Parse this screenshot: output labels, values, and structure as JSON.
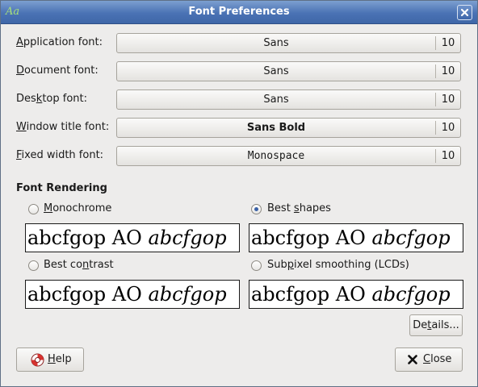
{
  "window": {
    "title": "Font Preferences",
    "icon": "font-preferences-icon",
    "icon_glyph": "Aa"
  },
  "fonts": [
    {
      "label_pre": "",
      "label_key": "A",
      "label_post": "pplication font:",
      "font": "Sans",
      "size": "10",
      "weight": "normal"
    },
    {
      "label_pre": "",
      "label_key": "D",
      "label_post": "ocument font:",
      "font": "Sans",
      "size": "10",
      "weight": "normal"
    },
    {
      "label_pre": "Des",
      "label_key": "k",
      "label_post": "top font:",
      "font": "Sans",
      "size": "10",
      "weight": "normal"
    },
    {
      "label_pre": "",
      "label_key": "W",
      "label_post": "indow title font:",
      "font": "Sans Bold",
      "size": "10",
      "weight": "bold"
    },
    {
      "label_pre": "",
      "label_key": "F",
      "label_post": "ixed width font:",
      "font": "Monospace",
      "size": "10",
      "weight": "normal"
    }
  ],
  "rendering": {
    "title": "Font Rendering",
    "sample_regular": "abcfgop AO ",
    "sample_italic": "abcfgop",
    "options": [
      {
        "label_pre": "",
        "label_key": "M",
        "label_post": "onochrome",
        "selected": false
      },
      {
        "label_pre": "Best ",
        "label_key": "s",
        "label_post": "hapes",
        "selected": true
      },
      {
        "label_pre": "Best co",
        "label_key": "n",
        "label_post": "trast",
        "selected": false
      },
      {
        "label_pre": "Sub",
        "label_key": "p",
        "label_post": "ixel smoothing (LCDs)",
        "selected": false
      }
    ]
  },
  "buttons": {
    "details_pre": "De",
    "details_key": "t",
    "details_post": "ails...",
    "help_key": "H",
    "help_post": "elp",
    "close_key": "C",
    "close_post": "lose"
  },
  "colors": {
    "titlebar": "#4a72b4",
    "radio_selected": "#3b61a6",
    "background": "#edeceb"
  }
}
